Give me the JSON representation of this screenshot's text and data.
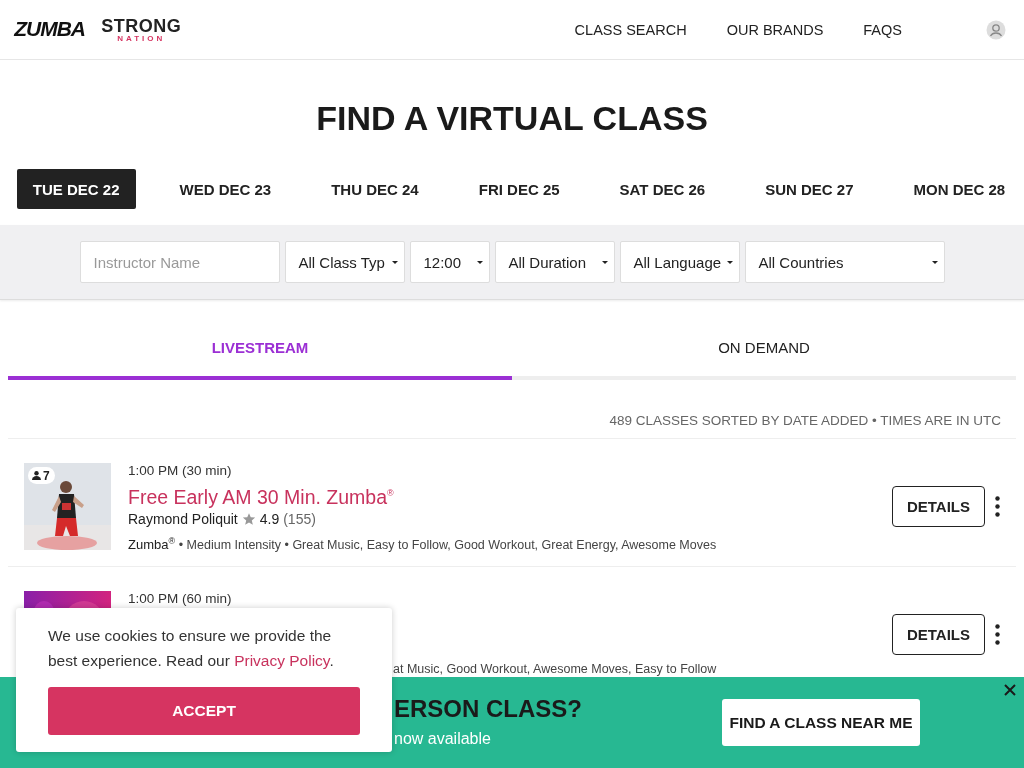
{
  "header": {
    "logo": "ZUMBA",
    "brand": "STRONG",
    "brand_sub": "NATION",
    "nav": [
      "CLASS SEARCH",
      "OUR BRANDS",
      "FAQS"
    ]
  },
  "title": "FIND A VIRTUAL CLASS",
  "dates": [
    {
      "label": "TUE DEC 22",
      "selected": true
    },
    {
      "label": "WED DEC 23",
      "selected": false
    },
    {
      "label": "THU DEC 24",
      "selected": false
    },
    {
      "label": "FRI DEC 25",
      "selected": false
    },
    {
      "label": "SAT DEC 26",
      "selected": false
    },
    {
      "label": "SUN DEC 27",
      "selected": false
    },
    {
      "label": "MON DEC 28",
      "selected": false
    }
  ],
  "filters": [
    {
      "kind": "input",
      "placeholder": "Instructor Name"
    },
    {
      "kind": "select",
      "value": "All Class Typ"
    },
    {
      "kind": "select",
      "value": "12:00"
    },
    {
      "kind": "select",
      "value": "All Duration"
    },
    {
      "kind": "select",
      "value": "All Language"
    },
    {
      "kind": "select",
      "value": "All Countries"
    }
  ],
  "modes": [
    {
      "label": "LIVESTREAM",
      "selected": true
    },
    {
      "label": "ON DEMAND",
      "selected": false
    }
  ],
  "summary": "489 CLASSES SORTED BY DATE ADDED • TIMES ARE IN UTC",
  "classes": [
    {
      "time": "1:00 PM (30 min)",
      "title": "Free Early AM 30 Min. Zumba$^{®}$",
      "instructor": "Raymond Poliquit",
      "rating": "4.9",
      "reviews": "(155)",
      "attendees": "7",
      "brand": "Zumba$^{®}$",
      "details": "• Medium Intensity • Great Music, Easy to Follow, Good Workout, Great Energy, Awesome Moves",
      "button": "DETAILS"
    },
    {
      "time": "1:00 PM (60 min)",
      "details": "at Music, Good Workout, Awesome Moves, Easy to Follow",
      "button": "DETAILS"
    }
  ],
  "cookie": {
    "message": "We use cookies to ensure we provide the best experience. Read our ",
    "link": "Privacy Policy",
    "after": ".",
    "button": "ACCEPT"
  },
  "banner": {
    "heading": "ERSON CLASS?",
    "text": "now available",
    "button": "FIND A CLASS NEAR ME"
  }
}
